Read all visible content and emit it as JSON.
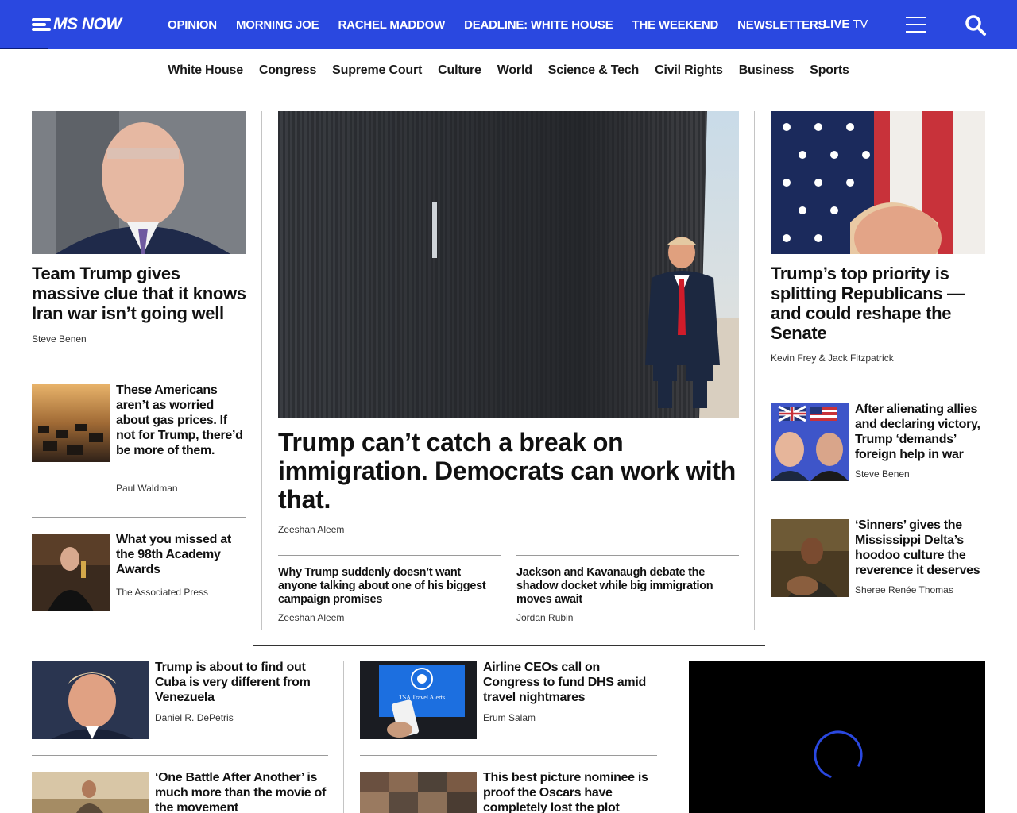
{
  "brand": {
    "name": "MS NOW",
    "accent": "#2a48e0"
  },
  "nav": {
    "items": [
      "OPINION",
      "MORNING JOE",
      "RACHEL MADDOW",
      "DEADLINE: WHITE HOUSE",
      "THE WEEKEND",
      "NEWSLETTERS"
    ],
    "live_bold": "LIVE",
    "live_rest": " TV"
  },
  "subnav": {
    "items": [
      "White House",
      "Congress",
      "Supreme Court",
      "Culture",
      "World",
      "Science & Tech",
      "Civil Rights",
      "Business",
      "Sports"
    ]
  },
  "left_col": {
    "top": {
      "headline": "Team Trump gives massive clue that it knows Iran war isn’t going well",
      "byline": "Steve Benen"
    },
    "items": [
      {
        "headline": "These Americans aren’t as worried about gas prices. If not for Trump, there’d be more of them.",
        "byline": "Paul Waldman"
      },
      {
        "headline": "What you missed at the 98th Academy Awards",
        "byline": "The Associated Press"
      }
    ]
  },
  "center_col": {
    "hero": {
      "headline": "Trump can’t catch a break on immigration. Democrats can work with that.",
      "byline": "Zeeshan Aleem"
    },
    "subs": [
      {
        "headline": "Why Trump suddenly doesn’t want anyone talking about one of his biggest campaign promises",
        "byline": "Zeeshan Aleem"
      },
      {
        "headline": "Jackson and Kavanaugh debate the shadow docket while big immigration moves await",
        "byline": "Jordan Rubin"
      }
    ]
  },
  "right_col": {
    "top": {
      "headline": "Trump’s top priority is splitting Republicans — and could reshape the Senate",
      "byline": "Kevin Frey & Jack Fitzpatrick"
    },
    "items": [
      {
        "headline": "After alienating allies and declaring victory, Trump ‘demands’ foreign help in war",
        "byline": "Steve Benen"
      },
      {
        "headline": "‘Sinners’ gives the Mississippi Delta’s hoodoo culture the reverence it deserves",
        "byline": "Sheree Renée Thomas"
      }
    ]
  },
  "bottom": {
    "col1": [
      {
        "headline": "Trump is about to find out Cuba is very different from Venezuela",
        "byline": "Daniel R. DePetris"
      },
      {
        "headline": "‘One Battle After Another’ is much more than the movie of the movement",
        "byline": ""
      }
    ],
    "col2": [
      {
        "headline": "Airline CEOs call on Congress to fund DHS amid travel nightmares",
        "byline": "Erum Salam"
      },
      {
        "headline": "This best picture nominee is proof the Oscars have completely lost the plot",
        "byline": ""
      }
    ],
    "tsa_screen_text": "TSA Travel Alerts"
  }
}
